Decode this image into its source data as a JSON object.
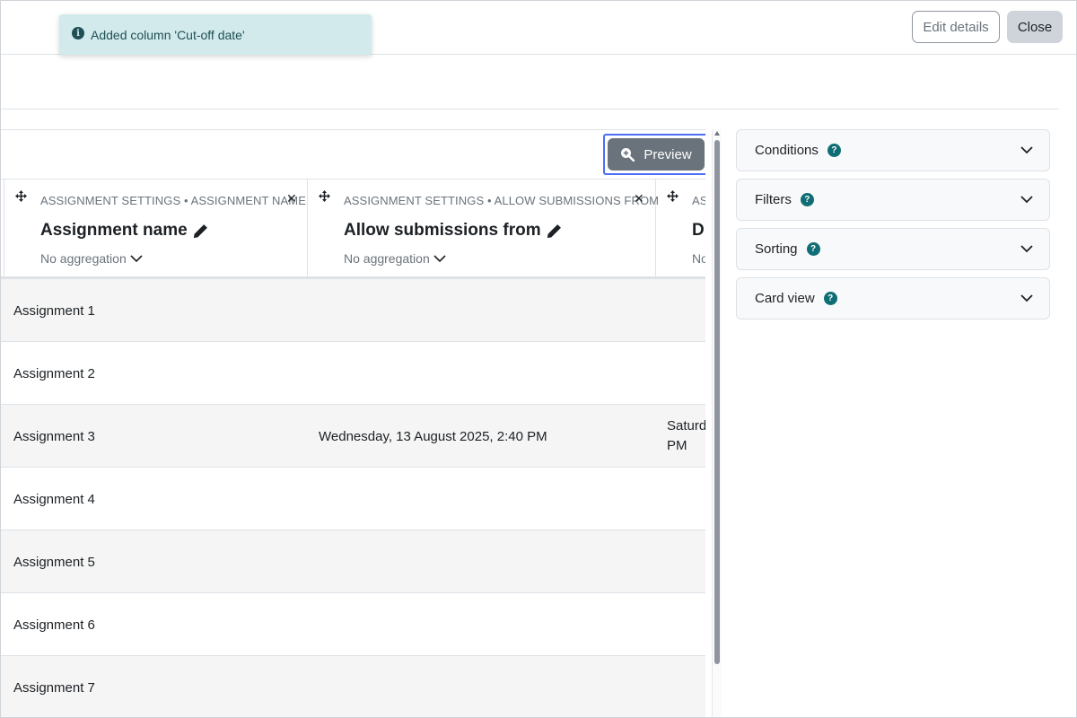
{
  "header": {
    "edit_label": "Edit details",
    "close_label": "Close"
  },
  "toast": {
    "message": "Added column 'Cut-off date'",
    "icon": "info-icon"
  },
  "toolbar": {
    "preview_label": "Preview",
    "preview_icon": "zoom-in-icon"
  },
  "columns": [
    {
      "source": "ASSIGNMENT SETTINGS • ASSIGNMENT NAME",
      "title": "Assignment name",
      "aggregation": "No aggregation"
    },
    {
      "source": "ASSIGNMENT SETTINGS • ALLOW SUBMISSIONS FROM",
      "title": "Allow submissions from",
      "aggregation": "No aggregation"
    },
    {
      "source": "AS",
      "title": "D",
      "aggregation": "No"
    }
  ],
  "rows": [
    {
      "name": "Assignment 1",
      "from": "",
      "due": ""
    },
    {
      "name": "Assignment 2",
      "from": "",
      "due": ""
    },
    {
      "name": "Assignment 3",
      "from": "Wednesday, 13 August 2025, 2:40 PM",
      "due": "Saturd",
      "due2": "PM"
    },
    {
      "name": "Assignment 4",
      "from": "",
      "due": ""
    },
    {
      "name": "Assignment 5",
      "from": "",
      "due": ""
    },
    {
      "name": "Assignment 6",
      "from": "",
      "due": ""
    },
    {
      "name": "Assignment 7",
      "from": "",
      "due": ""
    }
  ],
  "sidebar": {
    "cards": [
      {
        "label": "Conditions",
        "help": "?"
      },
      {
        "label": "Filters",
        "help": "?"
      },
      {
        "label": "Sorting",
        "help": "?"
      },
      {
        "label": "Card view",
        "help": "?"
      }
    ]
  },
  "colors": {
    "toast_bg": "#d2eaec",
    "help_icon": "#0f6e75",
    "preview_button": "#6a737b",
    "focus_ring": "#4c6ef5"
  }
}
